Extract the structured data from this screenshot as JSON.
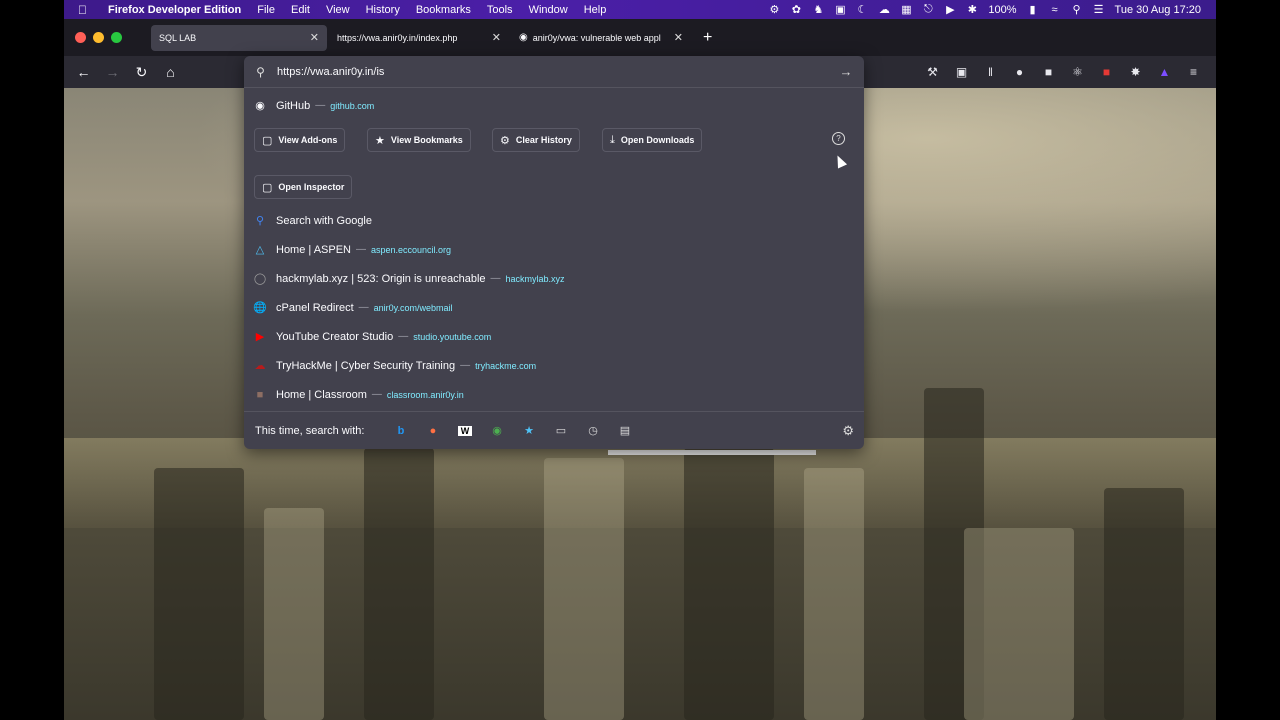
{
  "menubar": {
    "app_name": "Firefox Developer Edition",
    "items": [
      "File",
      "Edit",
      "View",
      "History",
      "Bookmarks",
      "Tools",
      "Window",
      "Help"
    ],
    "battery": "100%",
    "datetime": "Tue 30 Aug  17:20"
  },
  "tabs": [
    {
      "title": "SQL LAB",
      "active": true
    },
    {
      "title": "https://vwa.anir0y.in/index.php",
      "active": false
    },
    {
      "title": "anir0y/vwa: vulnerable web appl",
      "active": false
    }
  ],
  "urlbar": {
    "value": "https://vwa.anir0y.in/is"
  },
  "top_result": {
    "title": "GitHub",
    "url": "github.com"
  },
  "quick_actions": [
    {
      "label": "View Add-ons",
      "icon": "puzzle-icon"
    },
    {
      "label": "View Bookmarks",
      "icon": "star-icon"
    },
    {
      "label": "Clear History",
      "icon": "gear-icon"
    },
    {
      "label": "Open Downloads",
      "icon": "download-icon"
    }
  ],
  "inspector_action": {
    "label": "Open Inspector",
    "icon": "inspector-icon"
  },
  "search_google": {
    "label": "Search with Google"
  },
  "results": [
    {
      "title": "Home | ASPEN",
      "url": "aspen.eccouncil.org",
      "icon": "aspen-icon",
      "color": "#4fc3f7"
    },
    {
      "title": "hackmylab.xyz | 523: Origin is unreachable",
      "url": "hackmylab.xyz",
      "icon": "globe-icon",
      "color": "#cccccc"
    },
    {
      "title": "cPanel Redirect",
      "url": "anir0y.com/webmail",
      "icon": "globe-icon",
      "color": "#dddddd"
    },
    {
      "title": "YouTube Creator Studio",
      "url": "studio.youtube.com",
      "icon": "youtube-icon",
      "color": "#ff0000"
    },
    {
      "title": "TryHackMe | Cyber Security Training",
      "url": "tryhackme.com",
      "icon": "tryhackme-icon",
      "color": "#c11111"
    },
    {
      "title": "Home | Classroom",
      "url": "classroom.anir0y.in",
      "icon": "classroom-icon",
      "color": "#888888"
    }
  ],
  "footer": {
    "label": "This time, search with:"
  }
}
